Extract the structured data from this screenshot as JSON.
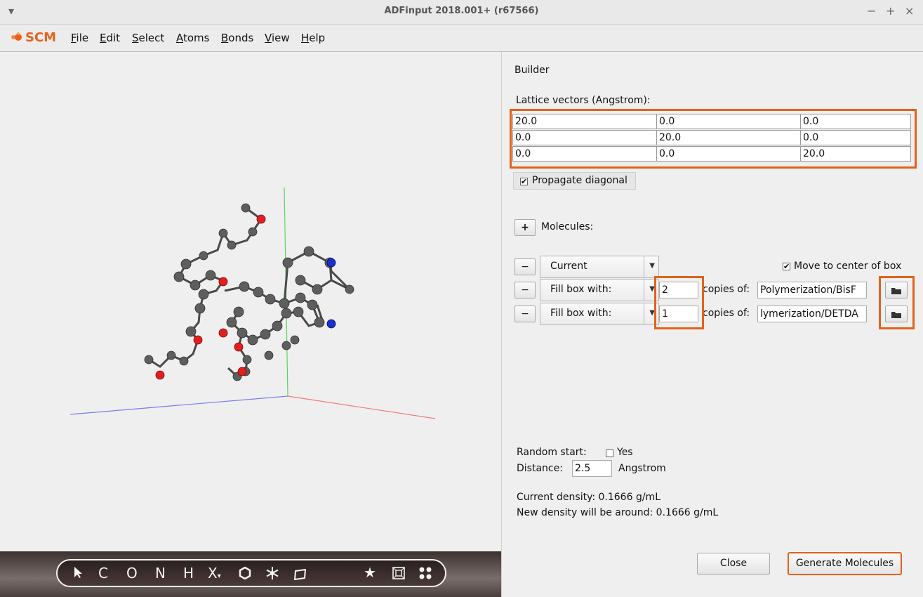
{
  "window": {
    "title": "ADFinput 2018.001+ (r67566)",
    "menu_arrow": "▾",
    "minimize": "−",
    "maximize": "+",
    "close": "×"
  },
  "menubar": {
    "logo": "SCM",
    "items": [
      {
        "label": "File"
      },
      {
        "label": "Edit"
      },
      {
        "label": "Select"
      },
      {
        "label": "Atoms"
      },
      {
        "label": "Bonds"
      },
      {
        "label": "View"
      },
      {
        "label": "Help"
      }
    ]
  },
  "toolbar": {
    "tools": [
      "C",
      "O",
      "N",
      "H",
      "X",
      "★"
    ],
    "pointer_icon": "pointer-icon",
    "ring_icon": "hexagon-icon",
    "snowflake_icon": "snowflake-icon",
    "plane_icon": "plane-icon",
    "box_icon": "box-icon",
    "grid_icon": "dots-icon"
  },
  "builder": {
    "heading": "Builder",
    "lattice_label": "Lattice vectors (Angstrom):",
    "lattice": [
      [
        "20.0",
        "0.0",
        "0.0"
      ],
      [
        "0.0",
        "20.0",
        "0.0"
      ],
      [
        "0.0",
        "0.0",
        "20.0"
      ]
    ],
    "propagate_label": "Propagate diagonal",
    "propagate_checked": true,
    "molecules_label": "Molecules:",
    "add_symbol": "+",
    "remove_symbol": "−",
    "rows": [
      {
        "combo": "Current",
        "move_label": "Move to center of box"
      },
      {
        "combo": "Fill box with:",
        "count": "2",
        "copies_label": "copies of:",
        "file": "Polymerization/BisF"
      },
      {
        "combo": "Fill box with:",
        "count": "1",
        "copies_label": "copies of:",
        "file": "lymerization/DETDA"
      }
    ],
    "random_start_label": "Random start:",
    "random_yes": "Yes",
    "distance_label": "Distance:",
    "distance_value": "2.5",
    "distance_unit": "Angstrom",
    "current_density": "Current density: 0.1666 g/mL",
    "new_density": "New density will be around: 0.1666 g/mL",
    "close_button": "Close",
    "generate_button": "Generate Molecules"
  }
}
